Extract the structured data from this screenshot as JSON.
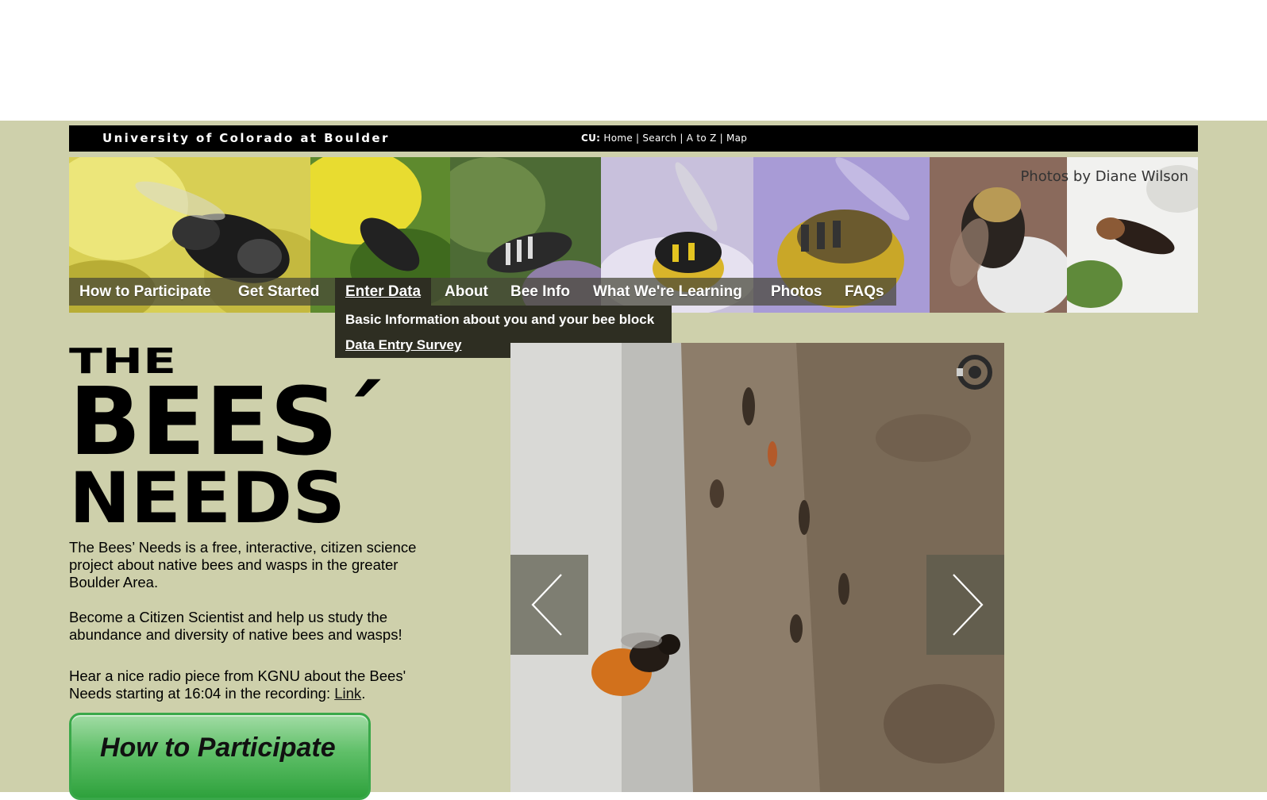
{
  "cu_bar": {
    "university": "University of Colorado at Boulder",
    "cu_label": "CU:",
    "links": [
      "Home",
      "Search",
      "A to Z",
      "Map"
    ],
    "separator": "|"
  },
  "banner": {
    "credit": "Photos by Diane Wilson"
  },
  "nav": {
    "items": [
      "How to Participate",
      "Get Started",
      "Enter Data",
      "About",
      "Bee Info",
      "What We're Learning",
      "Photos",
      "FAQs"
    ],
    "active": "Enter Data",
    "dropdown": [
      "Basic Information about you and your bee block",
      "Data Entry Survey"
    ]
  },
  "logo": {
    "line1": "THE",
    "line2": "BEES´",
    "line3": "NEEDS"
  },
  "intro": {
    "p1": "The Bees’ Needs is a free, interactive, citizen science project about native bees and wasps in the greater Boulder Area.",
    "p2": "Become a Citizen Scientist and help us study the abundance and diversity of native bees and wasps!",
    "p3_before": "Hear a nice radio piece from KGNU about the Bees' Needs starting at 16:04 in the recording: ",
    "p3_link": "Link",
    "p3_after": "."
  },
  "cta": {
    "label": "How to Participate"
  },
  "colors": {
    "page_background": "#ced0ab",
    "cu_bar": "#000000",
    "nav_active": "#2e2e22",
    "cta_green": "#3aa84a"
  },
  "icons": {
    "prev": "chevron-left-icon",
    "next": "chevron-right-icon",
    "play": "play-pause-icon"
  }
}
